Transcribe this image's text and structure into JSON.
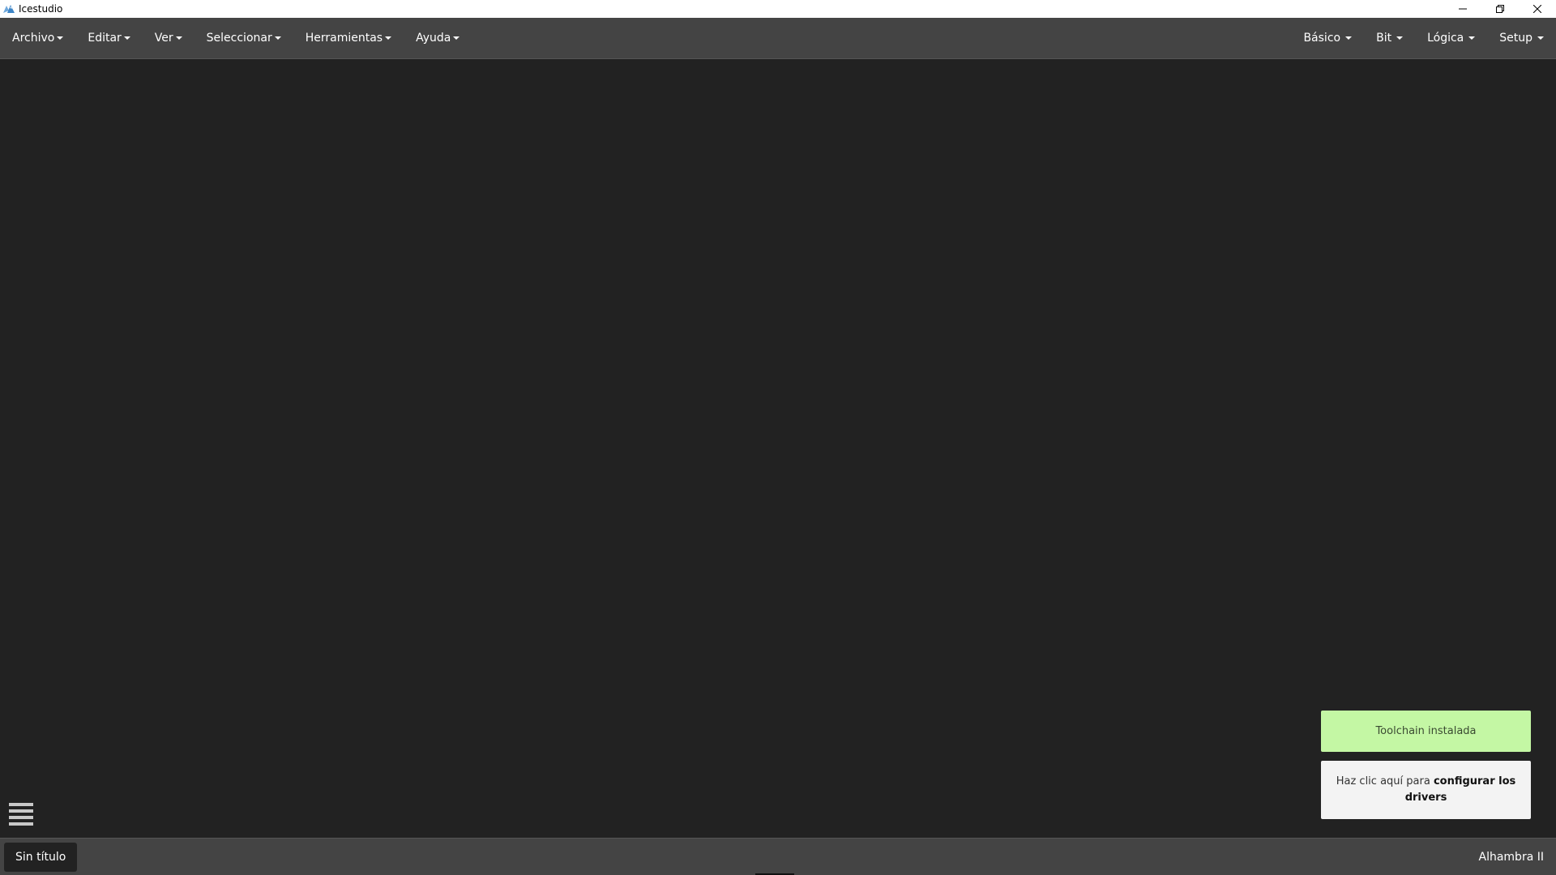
{
  "window": {
    "title": "Icestudio",
    "icon": "icestudio-logo-icon"
  },
  "menu": {
    "left": [
      {
        "label": "Archivo"
      },
      {
        "label": "Editar"
      },
      {
        "label": "Ver"
      },
      {
        "label": "Seleccionar"
      },
      {
        "label": "Herramientas"
      },
      {
        "label": "Ayuda"
      }
    ],
    "right": [
      {
        "label": "Básico"
      },
      {
        "label": "Bit"
      },
      {
        "label": "Lógica"
      },
      {
        "label": "Setup"
      }
    ]
  },
  "notifications": {
    "success": {
      "text": "Toolchain instalada",
      "color": "#c4f7a4"
    },
    "info": {
      "prefix": "Haz clic aquí para ",
      "bold": "configurar los drivers"
    }
  },
  "footer": {
    "file_name": "Sin título",
    "board": "Alhambra II"
  }
}
